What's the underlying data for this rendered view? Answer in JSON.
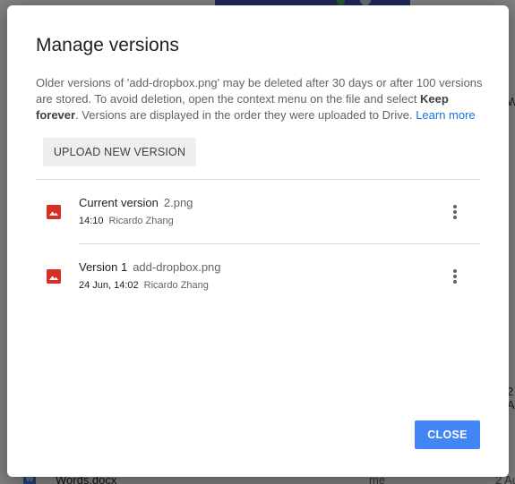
{
  "background": {
    "file_name": "Words.docx",
    "owner": "me",
    "date": "2 Au",
    "right_letter_top": "W",
    "right_letter_bottom": "2 A",
    "doc_icon_letter": "W"
  },
  "dialog": {
    "title": "Manage versions",
    "desc_part1": "Older versions of 'add-dropbox.png' may be deleted after 30 days or after 100 versions are stored. To avoid deletion, open the context menu on the file and select ",
    "desc_bold": "Keep forever",
    "desc_part2": ". Versions are displayed in the order they were uploaded to Drive. ",
    "learn_more": "Learn more",
    "upload_label": "UPLOAD NEW VERSION",
    "close_label": "CLOSE",
    "versions": [
      {
        "label": "Current version",
        "file": "2.png",
        "time": "14:10",
        "user": "Ricardo Zhang"
      },
      {
        "label": "Version 1",
        "file": "add-dropbox.png",
        "time": "24 Jun, 14:02",
        "user": "Ricardo Zhang"
      }
    ]
  },
  "colors": {
    "accent": "#4285f4",
    "link": "#1a73e8",
    "image_icon": "#d93025"
  },
  "icons": {
    "image": "image-file-icon",
    "more": "more-vert-icon"
  }
}
